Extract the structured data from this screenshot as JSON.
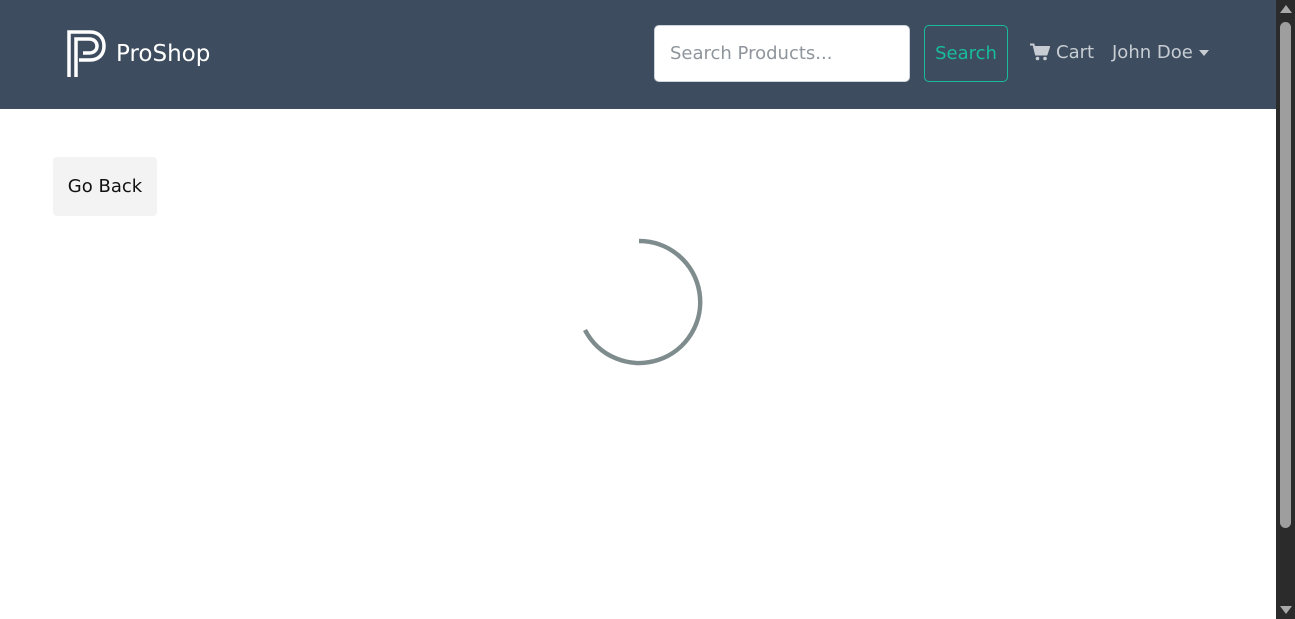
{
  "header": {
    "brand_name": "ProShop",
    "search_placeholder": "Search Products...",
    "search_button_label": "Search",
    "cart_label": "Cart",
    "user_name": "John Doe"
  },
  "main": {
    "go_back_label": "Go Back",
    "loading": true
  },
  "icons": {
    "brand": "proshop-logo-icon",
    "cart": "cart-icon",
    "dropdown": "caret-down-icon",
    "spinner": "loading-spinner-icon"
  },
  "colors": {
    "navbar_bg": "#3d4d5f",
    "accent": "#18bc9c",
    "nav_text": "#c8cdd3",
    "spinner": "#7f8c8d"
  }
}
